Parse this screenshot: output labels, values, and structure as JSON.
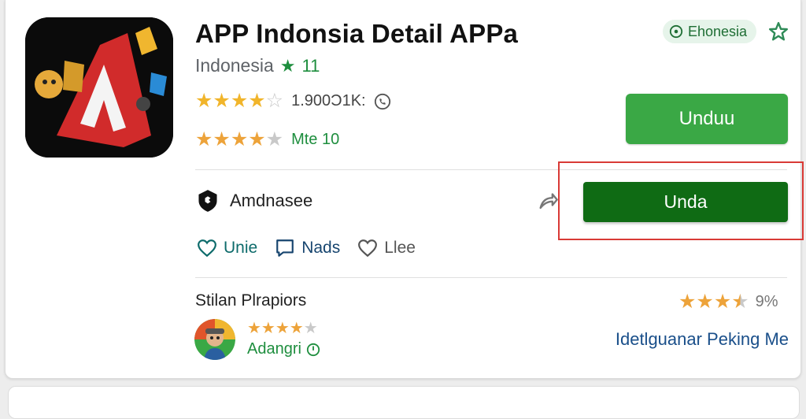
{
  "app": {
    "title": "APP Indonsia Detail APPa",
    "developer": "Indonesia",
    "developer_count": "11",
    "rating1": {
      "stars": 4,
      "text": "1.900Ɔ1K:"
    },
    "rating2": {
      "stars": 4,
      "text": "Mte 10"
    }
  },
  "region_badge": {
    "label": "Ehonesia"
  },
  "buttons": {
    "install": "Unduu",
    "unda": "Unda"
  },
  "org": {
    "name": "Amdnasee"
  },
  "actions": [
    {
      "label": "Unie"
    },
    {
      "label": "Nads"
    },
    {
      "label": "Llee"
    }
  ],
  "reviews": {
    "title": "Stilan Plrapiors",
    "summary_stars": 3.5,
    "summary_pct": "9%",
    "reviewer_stars": 4,
    "reviewer_name": "Adangri",
    "more_link": "Idetlguanar Peking Me"
  },
  "colors": {
    "install_button": "#3aa845",
    "unda_button": "#0f6b14",
    "highlight": "#d93a36",
    "star": "#f1b52b",
    "green_text": "#1e8e3e"
  }
}
